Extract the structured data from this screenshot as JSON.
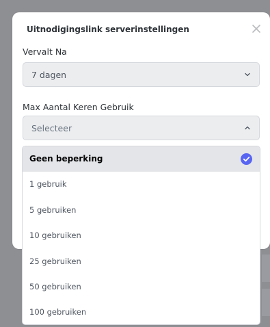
{
  "modal": {
    "title": "Uitnodigingslink serverinstellingen"
  },
  "expire": {
    "label": "Vervalt Na",
    "value": "7 dagen"
  },
  "max_uses": {
    "label": "Max Aantal Keren Gebruik",
    "placeholder": "Selecteer",
    "options": [
      {
        "label": "Geen beperking",
        "selected": true
      },
      {
        "label": "1 gebruik",
        "selected": false
      },
      {
        "label": "5 gebruiken",
        "selected": false
      },
      {
        "label": "10 gebruiken",
        "selected": false
      },
      {
        "label": "25 gebruiken",
        "selected": false
      },
      {
        "label": "50 gebruiken",
        "selected": false
      },
      {
        "label": "100 gebruiken",
        "selected": false
      }
    ]
  },
  "icons": {
    "close": "close-icon",
    "chevron_down": "chevron-down-icon",
    "chevron_up": "chevron-up-icon",
    "check": "check-circle-icon"
  },
  "colors": {
    "overlay": "#8e8f93",
    "accent": "#5865f2",
    "selected_row": "#e3e5e8",
    "input_bg": "#ebedef"
  }
}
